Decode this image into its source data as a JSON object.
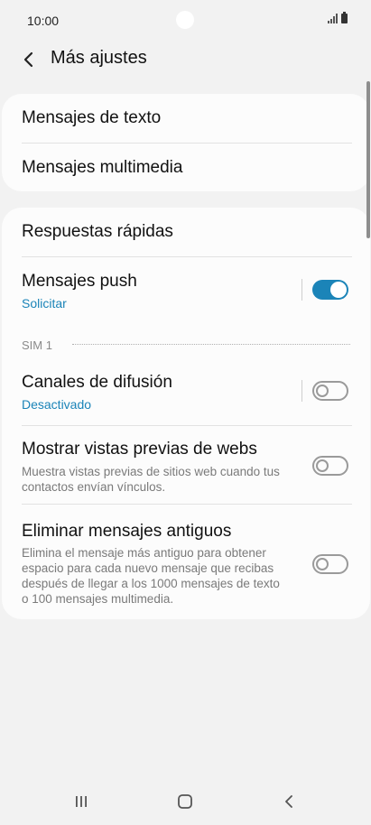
{
  "status_bar": {
    "time": "10:00"
  },
  "header": {
    "title": "Más ajustes"
  },
  "group1": {
    "items": [
      {
        "label": "Mensajes de texto"
      },
      {
        "label": "Mensajes multimedia"
      }
    ]
  },
  "group2": {
    "quick_replies": {
      "label": "Respuestas rápidas"
    },
    "push_messages": {
      "label": "Mensajes push",
      "value": "Solicitar",
      "enabled": true
    },
    "sim_label": "SIM 1",
    "cell_broadcast": {
      "label": "Canales de difusión",
      "value": "Desactivado",
      "enabled": false
    },
    "web_previews": {
      "label": "Mostrar vistas previas de webs",
      "description": "Muestra vistas previas de sitios web cuando tus contactos envían vínculos.",
      "enabled": false
    },
    "delete_old": {
      "label": "Eliminar mensajes antiguos",
      "description": "Elimina el mensaje más antiguo para obtener espacio para cada nuevo mensaje que recibas después de llegar a los 1000 mensajes de texto o 100 mensajes multimedia.",
      "enabled": false
    }
  },
  "colors": {
    "accent": "#1b84b8",
    "background": "#f2f2f2",
    "card": "#fcfcfc"
  },
  "icons": {
    "back": "chevron-left-icon",
    "signal": "signal-icon",
    "battery": "battery-icon",
    "nav_recents": "recents-icon",
    "nav_home": "home-icon",
    "nav_back": "nav-back-icon"
  }
}
